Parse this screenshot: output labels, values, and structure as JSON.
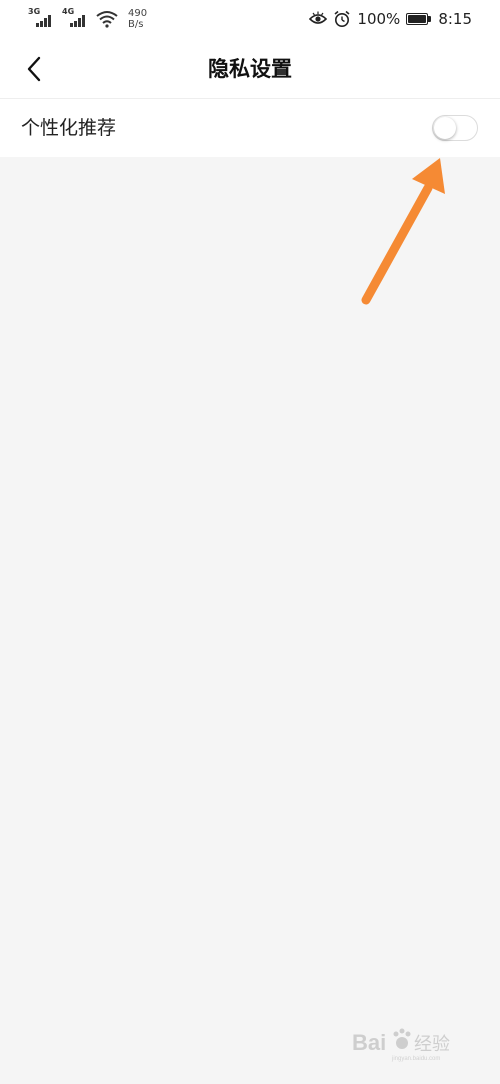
{
  "status_bar": {
    "net1_label": "3G",
    "net2_label": "4G",
    "speed_value": "490",
    "speed_unit": "B/s",
    "battery_percent": "100%",
    "time": "8:15",
    "icons": [
      "signal-icon",
      "wifi-icon",
      "eye-icon",
      "alarm-icon",
      "battery-icon"
    ]
  },
  "header": {
    "title": "隐私设置",
    "back_icon": "chevron-left-icon"
  },
  "settings": {
    "items": [
      {
        "label": "个性化推荐",
        "toggle_on": false
      }
    ]
  },
  "annotation": {
    "arrow_color": "#f58a34"
  },
  "watermark": {
    "text": "Bai 经验",
    "subtext": "jingyan.baidu.com"
  }
}
